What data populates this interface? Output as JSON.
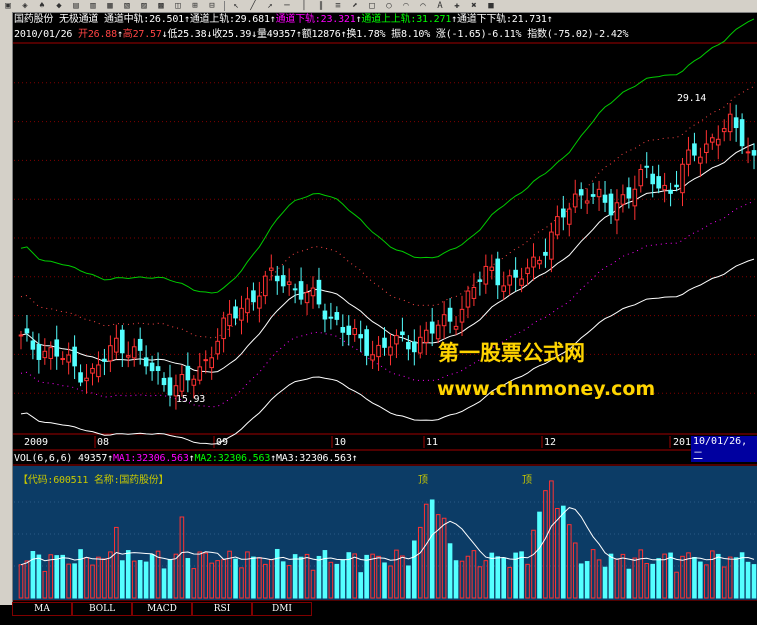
{
  "header1": [
    {
      "text": "国药股份",
      "color": "#ffffff"
    },
    {
      "text": " 无极通道 ",
      "color": "#ffffff"
    },
    {
      "text": "通道中轨:26.501",
      "color": "#ffffff"
    },
    {
      "text": "↑",
      "color": "#ffffff"
    },
    {
      "text": "通道上轨:29.681",
      "color": "#ffffff"
    },
    {
      "text": "↑",
      "color": "#ffffff"
    },
    {
      "text": "通道下轨:23.321",
      "color": "#ff00ff"
    },
    {
      "text": "↑",
      "color": "#ffffff"
    },
    {
      "text": "通道上上轨:31.271",
      "color": "#00ff00"
    },
    {
      "text": "↑",
      "color": "#ffffff"
    },
    {
      "text": "通道下下轨:21.731",
      "color": "#ffffff"
    },
    {
      "text": "↑",
      "color": "#ffffff"
    }
  ],
  "header2": [
    {
      "text": "2010/01/26 ",
      "color": "#ffffff"
    },
    {
      "text": "开26.88",
      "color": "#ff4444"
    },
    {
      "text": "↑",
      "color": "#ffffff"
    },
    {
      "text": "高27.57",
      "color": "#ff4444"
    },
    {
      "text": "↓",
      "color": "#ffffff"
    },
    {
      "text": "低25.38",
      "color": "#ffffff"
    },
    {
      "text": "↓",
      "color": "#ffffff"
    },
    {
      "text": "收25.39",
      "color": "#ffffff"
    },
    {
      "text": "↓",
      "color": "#ffffff"
    },
    {
      "text": "量49357",
      "color": "#ffffff"
    },
    {
      "text": "↑",
      "color": "#ffffff"
    },
    {
      "text": "额12876",
      "color": "#ffffff"
    },
    {
      "text": "↑",
      "color": "#ffffff"
    },
    {
      "text": "换1.78%",
      "color": "#ffffff"
    },
    {
      "text": " 振8.10%",
      "color": "#ffffff"
    },
    {
      "text": " 涨(-1.65)-6.11%",
      "color": "#ffffff"
    },
    {
      "text": " 指数(-75.02)-2.42%",
      "color": "#ffffff"
    }
  ],
  "annotations": {
    "high_label": "29.14",
    "low_label": "15.93"
  },
  "months": [
    "2009",
    "08",
    "09",
    "10",
    "11",
    "12",
    "201"
  ],
  "crosshair_date": "10/01/26,二",
  "vol_header": [
    {
      "text": "VOL(6,6,6) ",
      "color": "#ffffff"
    },
    {
      "text": "49357",
      "color": "#ffffff"
    },
    {
      "text": "↑",
      "color": "#ffffff"
    },
    {
      "text": "MA1:32306.563",
      "color": "#ff00ff"
    },
    {
      "text": "↑",
      "color": "#ffffff"
    },
    {
      "text": "MA2:32306.563",
      "color": "#00ff00"
    },
    {
      "text": "↑",
      "color": "#ffffff"
    },
    {
      "text": "MA3:32306.563",
      "color": "#ffffff"
    },
    {
      "text": "↑",
      "color": "#ffffff"
    }
  ],
  "vol_panel": {
    "code_label": "【代码:600511 名称:国药股份】",
    "chip1": "顶",
    "chip2": "顶"
  },
  "tabs": [
    "MA",
    "BOLL",
    "MACD",
    "RSI",
    "DMI"
  ],
  "watermark": {
    "cn": "第一股票公式网",
    "url": "www.chnmoney.com"
  },
  "colors": {
    "up": "#ff3232",
    "down": "#54ffff",
    "channel_mid": "#ffffff",
    "channel_upper": "#ff4444",
    "channel_lower": "#ff00ff",
    "channel_top": "#00cc00",
    "vol_bg": "#0c3c66"
  },
  "chart_data": {
    "type": "candlestick",
    "period": "2009-07 to 2010-01-26",
    "price_range": [
      15.93,
      29.14
    ],
    "channel_last": {
      "mid": 26.501,
      "upper": 29.681,
      "lower": 23.321,
      "upper_upper": 31.271,
      "lower_lower": 21.731
    },
    "close_trend": [
      18.5,
      18.2,
      18.0,
      17.8,
      17.3,
      17.0,
      16.8,
      17.6,
      18.4,
      18.2,
      17.6,
      16.9,
      16.5,
      16.2,
      16.5,
      17.1,
      18.3,
      19.2,
      19.9,
      20.5,
      21.1,
      21.6,
      21.4,
      21.0,
      20.6,
      20.1,
      19.6,
      19.0,
      18.4,
      18.1,
      18.1,
      18.4,
      18.3,
      18.5,
      18.9,
      19.2,
      19.6,
      20.4,
      21.3,
      22.0,
      21.6,
      21.2,
      21.8,
      22.6,
      23.5,
      24.4,
      25.4,
      25.9,
      25.4,
      24.8,
      25.5,
      26.1,
      26.6,
      26.2,
      25.8,
      26.8,
      27.6,
      28.1,
      28.6,
      29.0,
      28.5,
      27.4
    ]
  }
}
